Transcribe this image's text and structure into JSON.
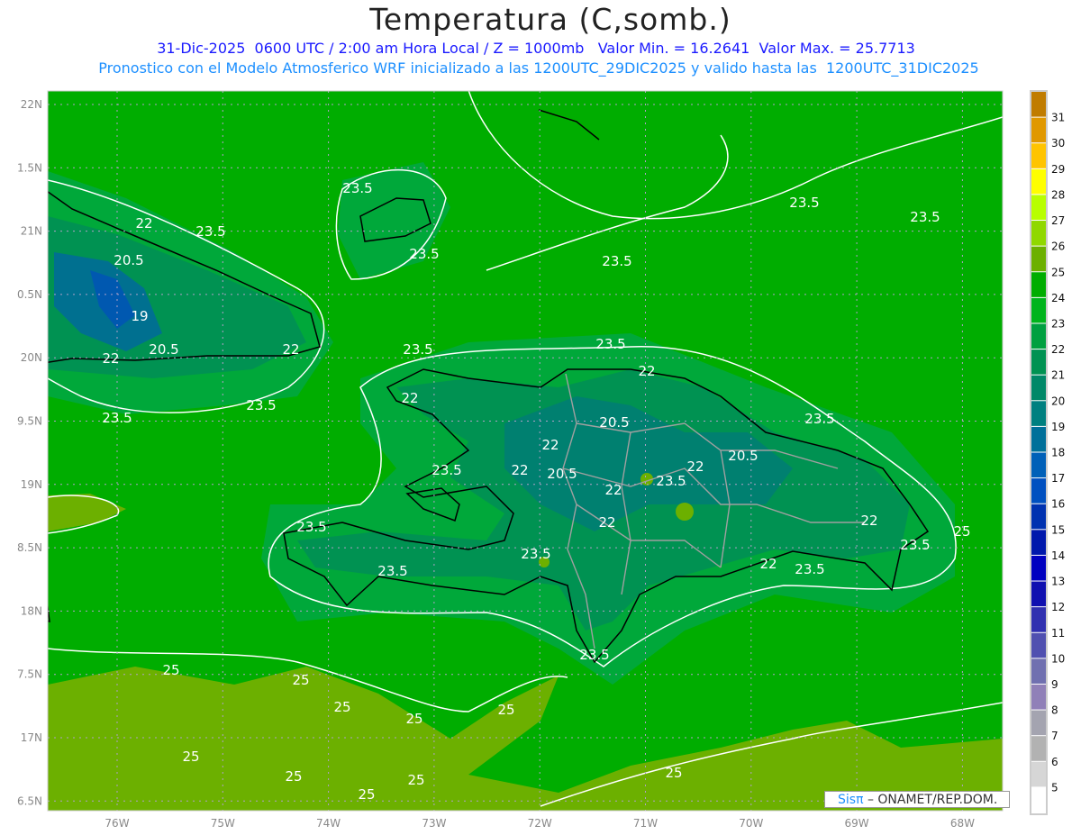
{
  "header": {
    "title": "Temperatura (C,somb.)",
    "line1": "31-Dic-2025  0600 UTC / 2:00 am Hora Local / Z = 1000mb   Valor Min. = 16.2641  Valor Max. = 25.7713",
    "line2": "Pronostico con el Modelo Atmosferico WRF inicializado a las 1200UTC_29DIC2025 y valido hasta las  1200UTC_31DIC2025"
  },
  "axes": {
    "lon_ticks": [
      "76W",
      "75W",
      "74W",
      "73W",
      "72W",
      "71W",
      "70W",
      "69W",
      "68W"
    ],
    "lat_ticks": [
      "22N",
      "1.5N",
      "21N",
      "0.5N",
      "20N",
      "9.5N",
      "19N",
      "8.5N",
      "18N",
      "7.5N",
      "17N",
      "6.5N"
    ]
  },
  "colorbar": {
    "levels": [
      "31",
      "30",
      "29",
      "28",
      "27",
      "26",
      "25",
      "24",
      "23",
      "22",
      "21",
      "20",
      "19",
      "18",
      "17",
      "16",
      "15",
      "14",
      "13",
      "12",
      "11",
      "10",
      "9",
      "8",
      "7",
      "6",
      "5"
    ],
    "colors": [
      "#c07c00",
      "#e09800",
      "#ffc400",
      "#ffff00",
      "#b8ff00",
      "#90d800",
      "#6cb000",
      "#00ad00",
      "#00b41c",
      "#00a040",
      "#009252",
      "#008868",
      "#008080",
      "#00709a",
      "#0060b8",
      "#0050c0",
      "#0032b0",
      "#0018ac",
      "#0000c0",
      "#1010b0",
      "#3030b0",
      "#5050b0",
      "#7070b0",
      "#9080b8",
      "#a4a4b0",
      "#b2b2b2",
      "#d6d6d6",
      "#ffffff"
    ]
  },
  "contour_labels": [
    "23.5",
    "23.5",
    "23.5",
    "23.5",
    "23.5",
    "22",
    "20.5",
    "19",
    "20.5",
    "22",
    "22",
    "23.5",
    "23.5",
    "23.5",
    "22",
    "23.5",
    "22",
    "20.5",
    "22",
    "20.5",
    "22",
    "23.5",
    "22",
    "20.5",
    "22",
    "23.5",
    "22",
    "23.5",
    "22",
    "23.5",
    "22",
    "23.5",
    "23.5",
    "23.5",
    "23.5",
    "23.5",
    "23.5",
    "25",
    "25",
    "25",
    "25",
    "25",
    "25",
    "25",
    "25",
    "25",
    "25",
    "25"
  ],
  "footer": {
    "credit_brand": "Sisπ",
    "credit_text": " –  ONAMET/REP.DOM."
  }
}
